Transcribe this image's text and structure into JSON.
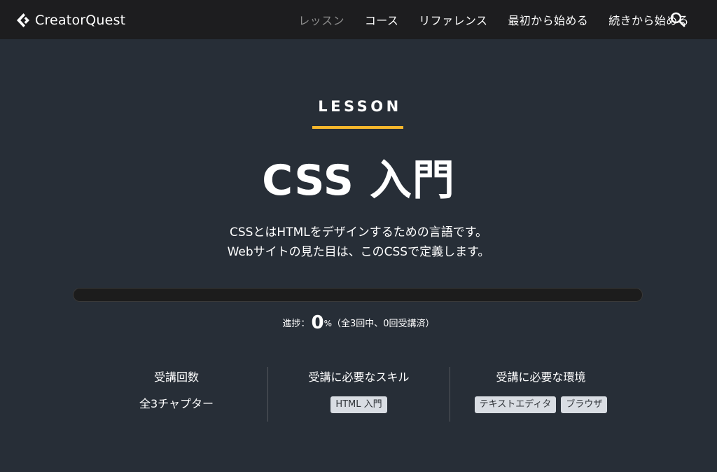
{
  "header": {
    "logo_text": "CreatorQuest",
    "nav": [
      {
        "label": "レッスン",
        "current": true
      },
      {
        "label": "コース",
        "current": false
      },
      {
        "label": "リファレンス",
        "current": false
      },
      {
        "label": "最初から始める",
        "current": false
      },
      {
        "label": "続きから始める",
        "current": false
      }
    ],
    "search_icon": "search-icon"
  },
  "hero": {
    "eyebrow": "LESSON",
    "title": "CSS 入門",
    "desc_line1": "CSSとはHTMLをデザインするための言語です。",
    "desc_line2": "Webサイトの見た目は、このCSSで定義します。"
  },
  "progress": {
    "fraction": 0,
    "label": "進捗：",
    "percent": "0",
    "unit": "%",
    "detail": "（全3回中、0回受講済）"
  },
  "info": {
    "count_head": "受講回数",
    "count_value": "全3チャプター",
    "skills_head": "受講に必要なスキル",
    "skills": [
      "HTML 入門"
    ],
    "env_head": "受講に必要な環境",
    "env": [
      "テキストエディタ",
      "ブラウザ"
    ]
  },
  "colors": {
    "background": "#272e37",
    "header": "#1d1d1f",
    "accent": "#f5b72c",
    "tag_bg": "#d9dde3"
  }
}
